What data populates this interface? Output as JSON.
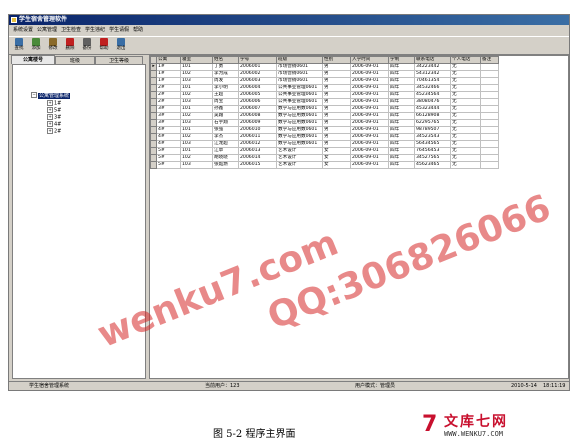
{
  "window": {
    "title": "学生宿舍管理软件"
  },
  "menu": [
    "系统设置",
    "公寓管理",
    "卫生检查",
    "学生违纪",
    "学生请假",
    "帮助"
  ],
  "toolbar": [
    {
      "label": "查找",
      "icon": "search-icon",
      "color": "#3a6ea5"
    },
    {
      "label": "添加",
      "icon": "add-user-icon",
      "color": "#4a8a3a"
    },
    {
      "label": "修改",
      "icon": "edit-icon",
      "color": "#8a6a2a"
    },
    {
      "label": "删除",
      "icon": "delete-icon",
      "color": "#c02020"
    },
    {
      "label": "备份",
      "icon": "backup-icon",
      "color": "#606060"
    },
    {
      "label": "帮助",
      "icon": "help-icon",
      "color": "#c02020"
    },
    {
      "label": "退出",
      "icon": "exit-icon",
      "color": "#3a6ea5"
    }
  ],
  "tabs": [
    "公寓楼号",
    "班级",
    "卫生等级"
  ],
  "tree": {
    "root": "公寓管理系统",
    "children": [
      "1#",
      "5#",
      "3#",
      "4#",
      "2#"
    ]
  },
  "table": {
    "headers": [
      "公寓",
      "寝室",
      "姓名",
      "学号",
      "班级",
      "性别",
      "入学时间",
      "学制",
      "联系电话",
      "个人电话",
      "备注"
    ],
    "rows": [
      [
        "1#",
        "101",
        "丁勇",
        "2006001",
        "市场营销0601",
        "男",
        "2006-09-01",
        "四年",
        "34223442",
        "无",
        ""
      ],
      [
        "1#",
        "102",
        "李为成",
        "2006002",
        "市场营销0601",
        "男",
        "2006-09-01",
        "四年",
        "54312342",
        "无",
        ""
      ],
      [
        "1#",
        "103",
        "周发",
        "2006003",
        "市场营销0601",
        "男",
        "2006-09-01",
        "四年",
        "70461354",
        "无",
        ""
      ],
      [
        "2#",
        "101",
        "李小明",
        "2006004",
        "公共事业管理0601",
        "男",
        "2006-09-01",
        "四年",
        "34532466",
        "无",
        ""
      ],
      [
        "2#",
        "102",
        "王超",
        "2006005",
        "公共事业管理0601",
        "男",
        "2006-09-01",
        "四年",
        "45234564",
        "无",
        ""
      ],
      [
        "2#",
        "103",
        "周宝",
        "2006006",
        "公共事业管理0601",
        "男",
        "2006-09-01",
        "四年",
        "38080476",
        "无",
        ""
      ],
      [
        "3#",
        "101",
        "孙鑫",
        "2006007",
        "数学与应用数0601",
        "男",
        "2006-09-01",
        "四年",
        "45323444",
        "无",
        ""
      ],
      [
        "3#",
        "102",
        "吴霜",
        "2006008",
        "数学与应用数0601",
        "男",
        "2006-09-01",
        "四年",
        "66128908",
        "无",
        ""
      ],
      [
        "3#",
        "103",
        "石宇翔",
        "2006009",
        "数学与应用数0601",
        "男",
        "2006-09-01",
        "四年",
        "62295765",
        "无",
        ""
      ],
      [
        "4#",
        "101",
        "张强",
        "2006010",
        "数学与应用数0601",
        "男",
        "2006-09-01",
        "四年",
        "98789507",
        "无",
        ""
      ],
      [
        "4#",
        "102",
        "李杰",
        "2006011",
        "数学与应用数0601",
        "男",
        "2006-09-01",
        "四年",
        "34523543",
        "无",
        ""
      ],
      [
        "4#",
        "103",
        "江龙超",
        "2006012",
        "数学与应用数0601",
        "男",
        "2006-09-01",
        "四年",
        "56434565",
        "无",
        ""
      ],
      [
        "5#",
        "101",
        "江草",
        "2006013",
        "艺术设计",
        "女",
        "2006-09-01",
        "四年",
        "76456453",
        "无",
        ""
      ],
      [
        "5#",
        "102",
        "胡晓晓",
        "2006014",
        "艺术设计",
        "女",
        "2006-09-01",
        "四年",
        "34527565",
        "无",
        ""
      ],
      [
        "5#",
        "103",
        "张灿燃",
        "2006015",
        "艺术设计",
        "女",
        "2006-09-01",
        "四年",
        "45623465",
        "无",
        ""
      ]
    ]
  },
  "status": {
    "app": "学生宿舍管理系统",
    "current_user": "当前用户：123",
    "mode": "用户模式：管理员",
    "date": "2010-5-14",
    "time": "18:11:19"
  },
  "watermarks": [
    "wenku7.com",
    "QQ:306826066"
  ],
  "caption": "图 5-2 程序主界面",
  "logo": {
    "mark": "7",
    "name": "文库七网",
    "url": "WWW.WENKU7.COM"
  }
}
